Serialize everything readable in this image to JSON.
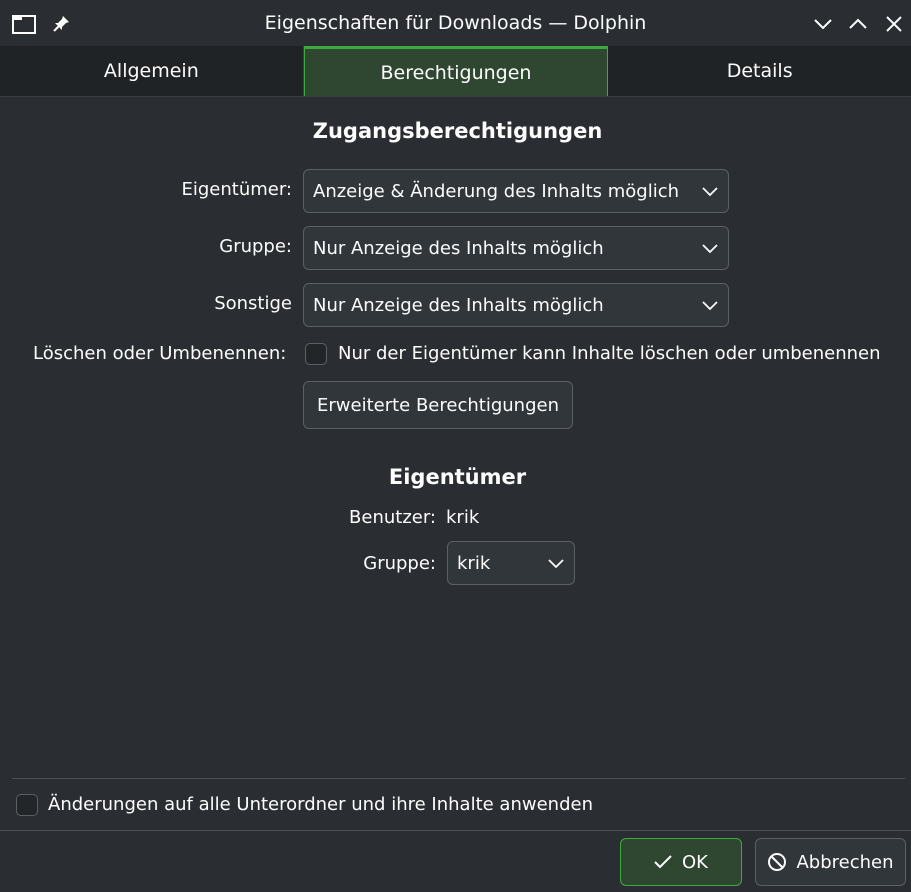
{
  "window": {
    "title": "Eigenschaften für Downloads — Dolphin",
    "icons": [
      "folder-icon",
      "pin-icon",
      "minimize-icon",
      "maximize-icon",
      "close-icon"
    ]
  },
  "tabs": [
    {
      "label": "Allgemein",
      "active": false
    },
    {
      "label": "Berechtigungen",
      "active": true
    },
    {
      "label": "Details",
      "active": false
    }
  ],
  "permissions": {
    "heading": "Zugangsberechtigungen",
    "owner_label": "Eigentümer:",
    "owner_value": "Anzeige & Änderung des Inhalts möglich",
    "group_label": "Gruppe:",
    "group_value": "Nur Anzeige des Inhalts möglich",
    "others_label": "Sonstige",
    "others_value": "Nur Anzeige des Inhalts möglich",
    "delete_label": "Löschen oder Umbenennen:",
    "delete_checkbox_text": "Nur der Eigentümer kann Inhalte löschen oder umbenennen",
    "delete_checked": false,
    "advanced_button": "Erweiterte Berechtigungen"
  },
  "ownership": {
    "heading": "Eigentümer",
    "user_label": "Benutzer:",
    "user_value": "krik",
    "group_label": "Gruppe:",
    "group_value": "krik"
  },
  "footer": {
    "apply_recursive_text": "Änderungen auf alle Unterordner und ihre Inhalte anwenden",
    "apply_recursive_checked": false,
    "ok_label": "OK",
    "cancel_label": "Abbrechen"
  },
  "colors": {
    "accent": "#3daa3d",
    "background": "#2a2e32",
    "text": "#fcfcfc"
  }
}
